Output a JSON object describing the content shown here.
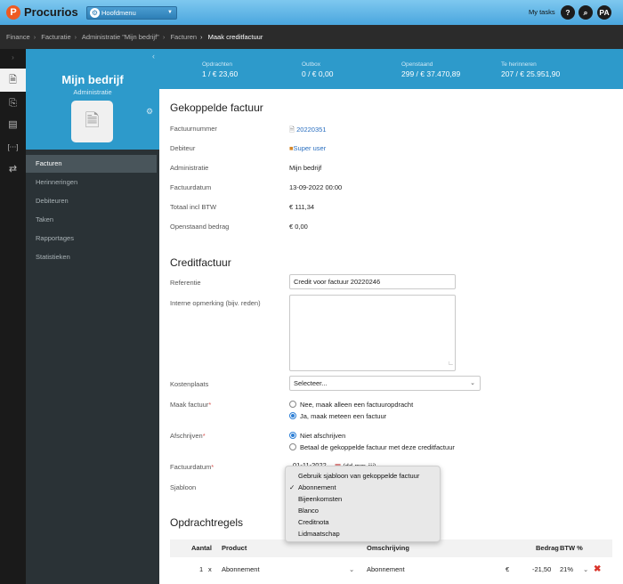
{
  "topbar": {
    "logo_mark": "P",
    "app_name": "Procurios",
    "menu_label": "Hoofdmenu",
    "my_tasks": "My tasks",
    "help_icon": "?",
    "search_icon": "⌕",
    "avatar": "PA"
  },
  "breadcrumb": [
    "Finance",
    "Facturatie",
    "Administratie \"Mijn bedrijf\"",
    "Facturen",
    "Maak creditfactuur"
  ],
  "sidebar": {
    "title": "Mijn bedrijf",
    "subtitle": "Administratie",
    "items": [
      "Facturen",
      "Herinneringen",
      "Debiteuren",
      "Taken",
      "Rapportages",
      "Statistieken"
    ],
    "active": "Facturen"
  },
  "stats": [
    {
      "label": "Opdrachten",
      "value": "1 / € 23,60"
    },
    {
      "label": "Outbox",
      "value": "0 / € 0,00"
    },
    {
      "label": "Openstaand",
      "value": "299 / € 37.470,89"
    },
    {
      "label": "Te herinneren",
      "value": "207 / € 25.951,90"
    }
  ],
  "linked": {
    "heading": "Gekoppelde factuur",
    "fields": [
      {
        "label": "Factuurnummer",
        "value": "20220351"
      },
      {
        "label": "Debiteur",
        "value": "Super user"
      },
      {
        "label": "Administratie",
        "value": "Mijn bedrijf"
      },
      {
        "label": "Factuurdatum",
        "value": "13-09-2022 00:00"
      },
      {
        "label": "Totaal incl BTW",
        "value": "€ 111,34"
      },
      {
        "label": "Openstaand bedrag",
        "value": "€ 0,00"
      }
    ]
  },
  "credit": {
    "heading": "Creditfactuur",
    "referentie_label": "Referentie",
    "referentie_value": "Credit voor factuur 20220246",
    "opmerking_label": "Interne opmerking (bijv. reden)",
    "kostenplaats_label": "Kostenplaats",
    "kostenplaats_value": "Selecteer...",
    "maak_label": "Maak factuur",
    "maak_opt1": "Nee, maak alleen een factuuropdracht",
    "maak_opt2": "Ja, maak meteen een factuur",
    "afschrijven_label": "Afschrijven",
    "afschrijven_opt1": "Niet afschrijven",
    "afschrijven_opt2": "Betaal de gekoppelde factuur met deze creditfactuur",
    "factuurdatum_label": "Factuurdatum",
    "factuurdatum_value": "01-11-2022",
    "factuurdatum_hint": "(dd-mm-jjjj)",
    "sjabloon_label": "Sjabloon"
  },
  "dropdown": {
    "options": [
      "Gebruik sjabloon van gekoppelde factuur",
      "Abonnement",
      "Bijeenkomsten",
      "Blanco",
      "Creditnota",
      "Lidmaatschap"
    ],
    "selected": "Abonnement"
  },
  "lines": {
    "heading": "Opdrachtregels",
    "columns": [
      "Aantal",
      "Product",
      "Omschrijving",
      "Bedrag",
      "BTW %"
    ],
    "rows": [
      {
        "qty": "1",
        "x": "x",
        "product": "Abonnement",
        "description": "Abonnement",
        "currency": "€",
        "amount": "-21,50",
        "vat": "21%"
      }
    ]
  }
}
